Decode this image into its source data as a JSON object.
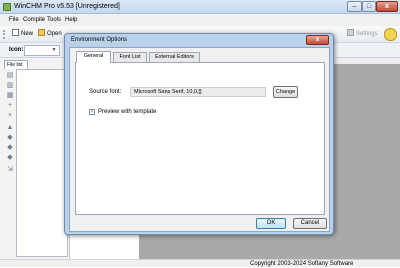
{
  "window": {
    "title": "WinCHM Pro v5.53 [Unregistered]",
    "buttons": {
      "minimize": "–",
      "maximize": "□",
      "close": "x"
    }
  },
  "menu": {
    "items": [
      "File",
      "Compile",
      "Tools",
      "Help"
    ]
  },
  "toolbar": {
    "new_label": "New",
    "open_label": "Open",
    "right_ghost": "Settings"
  },
  "iconbar": {
    "label": "Icon:",
    "combo_value": ""
  },
  "left_panel": {
    "tab_label": "File list"
  },
  "dialog": {
    "title": "Environment Options",
    "close_label": "x",
    "tabs": [
      {
        "label": "General",
        "active": true
      },
      {
        "label": "Font List",
        "active": false
      },
      {
        "label": "External Editors",
        "active": false
      }
    ],
    "source_font": {
      "label": "Source font:",
      "value": "Microsoft Sans Serif, 10,0,[]"
    },
    "change_button": "Change",
    "preview_checkbox": {
      "label": "Preview with template",
      "checked": true,
      "mark": "✓"
    },
    "ok_button": "OK",
    "cancel_button": "Cancel"
  },
  "status": {
    "copyright": "Copyright 2003-2024 Softany Software"
  },
  "colors": {
    "title_bar": "#c4d8ef",
    "dialog_frame": "#b9d1ea",
    "workspace": "#a9a9a9",
    "close_red": "#c14a34"
  }
}
